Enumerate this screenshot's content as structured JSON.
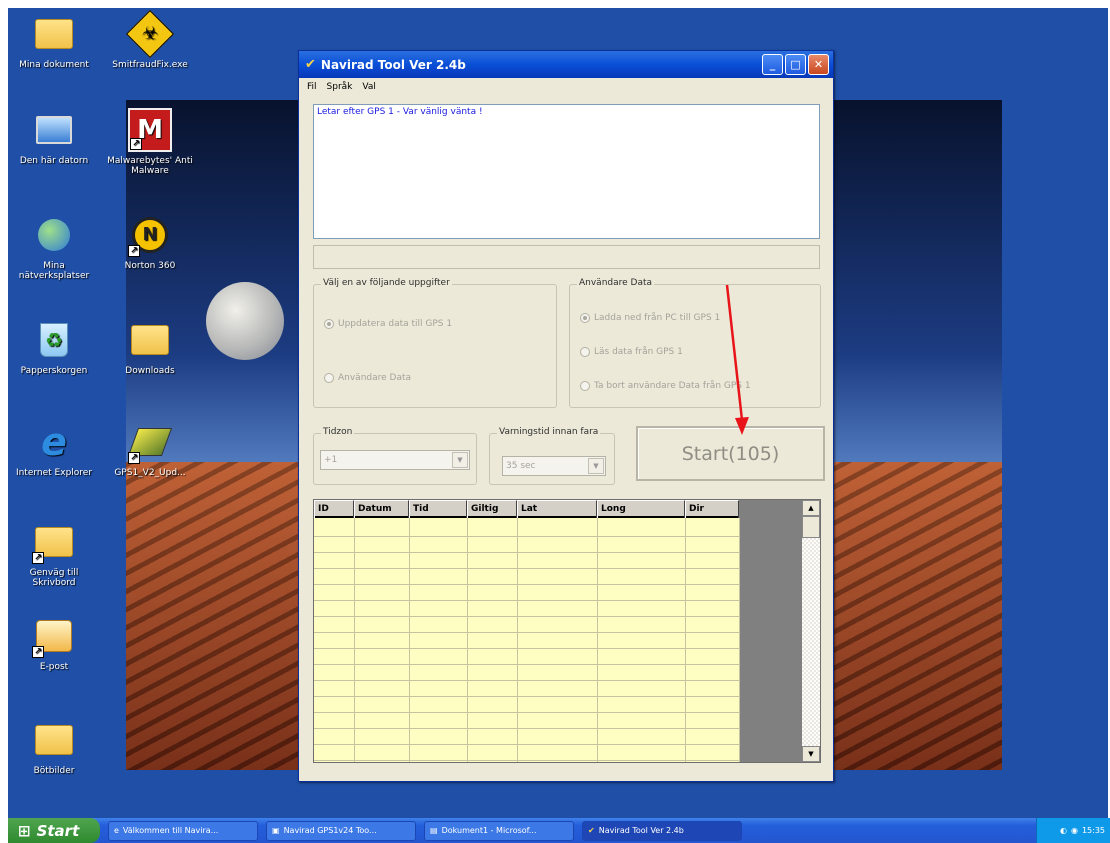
{
  "desktop_icons": [
    {
      "label": "Mina dokument",
      "icon": "folder-documents-icon"
    },
    {
      "label": "SmitfraudFix.exe",
      "icon": "biohazard-icon"
    },
    {
      "label": "Den här datorn",
      "icon": "computer-icon"
    },
    {
      "label": "Malwarebytes' Anti Malware",
      "icon": "malwarebytes-icon"
    },
    {
      "label": "Mina nätverksplatser",
      "icon": "network-icon"
    },
    {
      "label": "Norton 360",
      "icon": "norton-icon"
    },
    {
      "label": "Papperskorgen",
      "icon": "recycle-bin-icon"
    },
    {
      "label": "Downloads",
      "icon": "folder-icon"
    },
    {
      "label": "Internet Explorer",
      "icon": "ie-icon"
    },
    {
      "label": "GPS1_V2_Upd...",
      "icon": "gps-update-icon"
    },
    {
      "label": "Genväg till Skrivbord",
      "icon": "folder-shortcut-icon"
    },
    {
      "label": "E-post",
      "icon": "email-icon"
    },
    {
      "label": "Bötbilder",
      "icon": "folder-icon"
    }
  ],
  "window": {
    "title": "Navirad Tool Ver 2.4b",
    "menu": [
      "Fil",
      "Språk",
      "Val"
    ],
    "log_text": "Letar efter GPS 1 - Var vänlig vänta !",
    "group_tasks": {
      "label": "Välj en av följande uppgifter",
      "options": [
        {
          "label": "Uppdatera data till GPS 1",
          "selected": true
        },
        {
          "label": "Användare Data",
          "selected": false
        }
      ]
    },
    "group_user_data": {
      "label": "Användare Data",
      "options": [
        {
          "label": "Ladda ned från PC till GPS 1",
          "selected": true
        },
        {
          "label": "Läs data från GPS 1",
          "selected": false
        },
        {
          "label": "Ta bort användare Data från GPS 1",
          "selected": false
        }
      ]
    },
    "timezone": {
      "label": "Tidzon",
      "value": "+1"
    },
    "warning_time": {
      "label": "Varningstid innan fara",
      "value": "35 sec"
    },
    "start_button": "Start(105)",
    "grid_columns": [
      "ID",
      "Datum",
      "Tid",
      "Giltig",
      "Lat",
      "Long",
      "Dir"
    ]
  },
  "taskbar": {
    "start_label": "Start",
    "tasks": [
      "Välkommen till Navira...",
      "Navirad GPS1v24 Too...",
      "Dokument1 - Microsof...",
      "Navirad Tool Ver 2.4b"
    ],
    "clock": "15:35"
  },
  "colors": {
    "annotation_arrow": "#e8141a",
    "grid_background": "#fffec2",
    "titlebar": "#0a4fd7"
  }
}
